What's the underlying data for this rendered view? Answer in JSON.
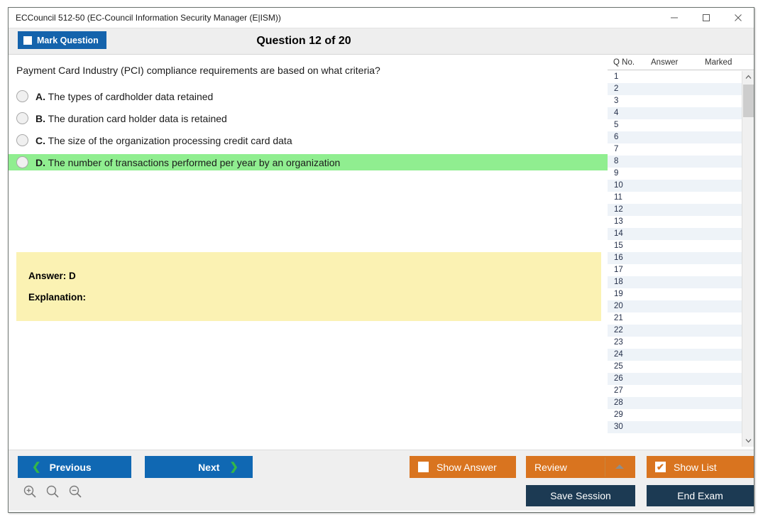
{
  "window": {
    "title": "ECCouncil 512-50 (EC-Council Information Security Manager (E|ISM))",
    "minimize_icon": "minimize-icon",
    "maximize_icon": "maximize-icon",
    "close_icon": "close-icon"
  },
  "header": {
    "mark_question_label": "Mark Question",
    "question_counter": "Question 12 of 20"
  },
  "question": {
    "text": "Payment Card Industry (PCI) compliance requirements are based on what criteria?",
    "options": [
      {
        "letter": "A.",
        "text": "The types of cardholder data retained",
        "highlighted": false,
        "selected": false
      },
      {
        "letter": "B.",
        "text": "The duration card holder data is retained",
        "highlighted": false,
        "selected": false
      },
      {
        "letter": "C.",
        "text": "The size of the organization processing credit card data",
        "highlighted": false,
        "selected": false
      },
      {
        "letter": "D.",
        "text": "The number of transactions performed per year by an organization",
        "highlighted": true,
        "selected": false
      }
    ]
  },
  "answer_panel": {
    "answer": "Answer: D",
    "explanation": "Explanation:"
  },
  "question_list": {
    "columns": [
      "Q No.",
      "Answer",
      "Marked"
    ],
    "rows": [
      {
        "no": "1",
        "answer": "",
        "marked": ""
      },
      {
        "no": "2",
        "answer": "",
        "marked": ""
      },
      {
        "no": "3",
        "answer": "",
        "marked": ""
      },
      {
        "no": "4",
        "answer": "",
        "marked": ""
      },
      {
        "no": "5",
        "answer": "",
        "marked": ""
      },
      {
        "no": "6",
        "answer": "",
        "marked": ""
      },
      {
        "no": "7",
        "answer": "",
        "marked": ""
      },
      {
        "no": "8",
        "answer": "",
        "marked": ""
      },
      {
        "no": "9",
        "answer": "",
        "marked": ""
      },
      {
        "no": "10",
        "answer": "",
        "marked": ""
      },
      {
        "no": "11",
        "answer": "",
        "marked": ""
      },
      {
        "no": "12",
        "answer": "",
        "marked": ""
      },
      {
        "no": "13",
        "answer": "",
        "marked": ""
      },
      {
        "no": "14",
        "answer": "",
        "marked": ""
      },
      {
        "no": "15",
        "answer": "",
        "marked": ""
      },
      {
        "no": "16",
        "answer": "",
        "marked": ""
      },
      {
        "no": "17",
        "answer": "",
        "marked": ""
      },
      {
        "no": "18",
        "answer": "",
        "marked": ""
      },
      {
        "no": "19",
        "answer": "",
        "marked": ""
      },
      {
        "no": "20",
        "answer": "",
        "marked": ""
      },
      {
        "no": "21",
        "answer": "",
        "marked": ""
      },
      {
        "no": "22",
        "answer": "",
        "marked": ""
      },
      {
        "no": "23",
        "answer": "",
        "marked": ""
      },
      {
        "no": "24",
        "answer": "",
        "marked": ""
      },
      {
        "no": "25",
        "answer": "",
        "marked": ""
      },
      {
        "no": "26",
        "answer": "",
        "marked": ""
      },
      {
        "no": "27",
        "answer": "",
        "marked": ""
      },
      {
        "no": "28",
        "answer": "",
        "marked": ""
      },
      {
        "no": "29",
        "answer": "",
        "marked": ""
      },
      {
        "no": "30",
        "answer": "",
        "marked": ""
      }
    ],
    "scroll_up_icon": "chevron-up-icon",
    "scroll_down_icon": "chevron-down-icon"
  },
  "footer": {
    "previous_label": "Previous",
    "next_label": "Next",
    "previous_icon": "chevron-left-icon",
    "next_icon": "chevron-right-icon",
    "show_answer_label": "Show Answer",
    "show_answer_checked": false,
    "review_label": "Review",
    "review_caret_icon": "caret-up-icon",
    "show_list_label": "Show List",
    "show_list_checked": true,
    "show_list_tick": "✔",
    "save_session_label": "Save Session",
    "end_exam_label": "End Exam",
    "zoom_in_icon": "zoom-in-icon",
    "zoom_reset_icon": "zoom-icon",
    "zoom_out_icon": "zoom-out-icon"
  },
  "colors": {
    "accent_blue": "#1068b3",
    "accent_orange": "#d9741f",
    "navy": "#1c3a53",
    "highlight_green": "#90ee90",
    "answer_yellow": "#fbf2b3",
    "chevron_green": "#33b64a"
  }
}
